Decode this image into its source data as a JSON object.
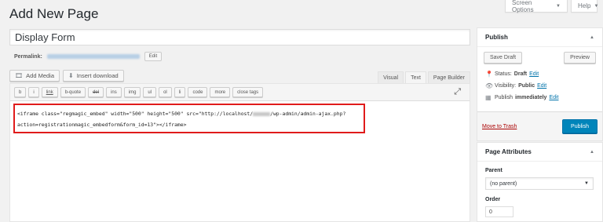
{
  "header": {
    "title": "Add New Page",
    "screen_options": "Screen Options",
    "help": "Help"
  },
  "post": {
    "title_value": "Display Form",
    "permalink_label": "Permalink:",
    "permalink_edit": "Edit"
  },
  "media": {
    "add_media": "Add Media",
    "insert_download": "Insert download"
  },
  "editor_tabs": [
    "Visual",
    "Text",
    "Page Builder"
  ],
  "quicktags": [
    "b",
    "i",
    "link",
    "b-quote",
    "del",
    "ins",
    "img",
    "ul",
    "ol",
    "li",
    "code",
    "more",
    "close tags"
  ],
  "editor": {
    "line1_a": "<iframe class=\"regmagic_embed\" width=\"500\" height=\"500\" src=\"http://localhost/",
    "line1_b": "/wp-admin/admin-ajax.php?",
    "line2": "action=registrationmagic_embedform&form_id=13\"></iframe>"
  },
  "publish": {
    "title": "Publish",
    "save_draft": "Save Draft",
    "preview": "Preview",
    "status_label": "Status:",
    "status_value": "Draft",
    "visibility_label": "Visibility:",
    "visibility_value": "Public",
    "publish_label": "Publish",
    "publish_value": "immediately",
    "edit": "Edit",
    "move_to_trash": "Move to Trash",
    "publish_button": "Publish"
  },
  "attributes": {
    "title": "Page Attributes",
    "parent_label": "Parent",
    "parent_value": "(no parent)",
    "order_label": "Order",
    "order_value": "0"
  },
  "colors": {
    "accent": "#0085ba",
    "highlight_border": "#e01b1b",
    "trash": "#a00"
  }
}
